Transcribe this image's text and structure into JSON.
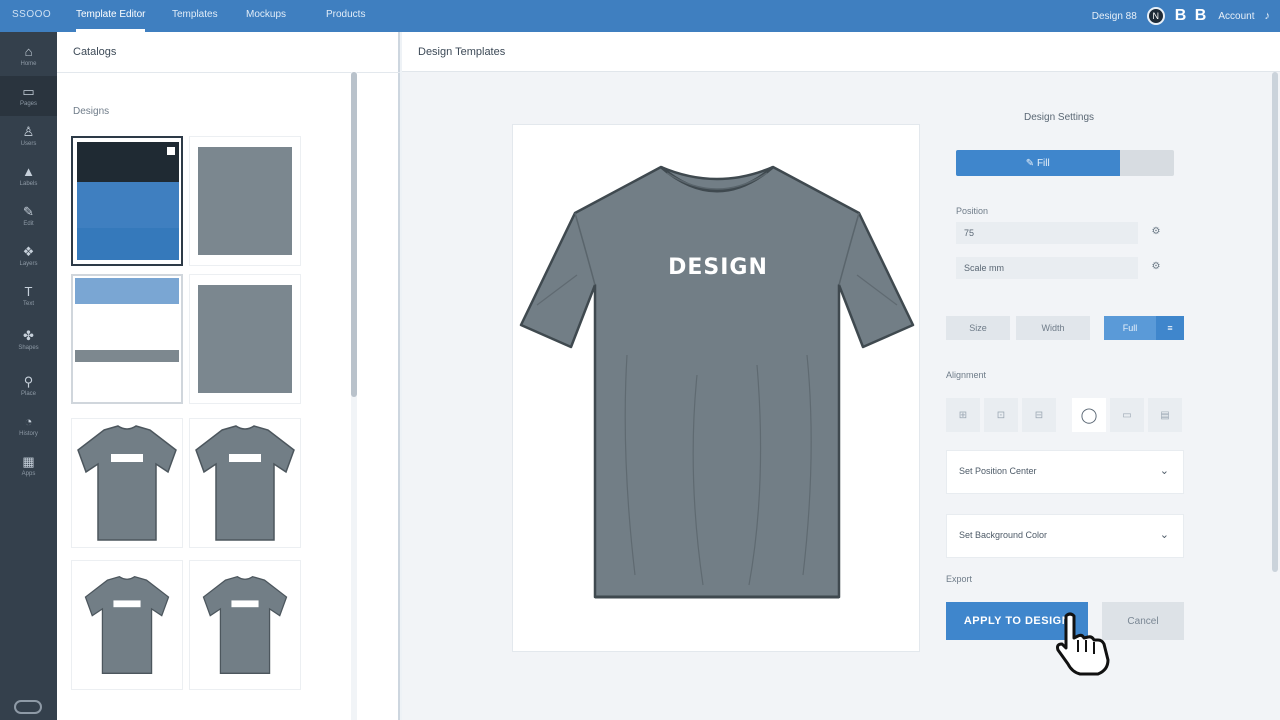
{
  "app": {
    "brand": "SSOOO",
    "tabs": [
      "Template Editor",
      "Templates",
      "Mockups",
      "Products"
    ],
    "active_tab": 0,
    "top_right": {
      "user_text": "Design 88",
      "avatar_initial": "N",
      "bb": "B B",
      "account_text": "Account"
    },
    "accent": "#3f7fc0"
  },
  "rail": {
    "items": [
      {
        "icon": "home-icon",
        "glyph": "⌂",
        "label": "Home"
      },
      {
        "icon": "file-icon",
        "glyph": "▭",
        "label": "Pages"
      },
      {
        "icon": "user-icon",
        "glyph": "♙",
        "label": "Users"
      },
      {
        "icon": "tag-icon",
        "glyph": "▲",
        "label": "Labels"
      },
      {
        "icon": "edit-icon",
        "glyph": "✎",
        "label": "Edit"
      },
      {
        "icon": "layers-icon",
        "glyph": "❖",
        "label": "Layers"
      },
      {
        "icon": "text-icon",
        "glyph": "T",
        "label": "Text"
      },
      {
        "icon": "share-icon",
        "glyph": "✤",
        "label": "Shapes"
      },
      {
        "icon": "pin-icon",
        "glyph": "⚲",
        "label": "Place"
      },
      {
        "icon": "clock-icon",
        "glyph": "◔",
        "label": "History"
      },
      {
        "icon": "grid-icon",
        "glyph": "▦",
        "label": "Apps"
      }
    ]
  },
  "left_panel": {
    "title": "Catalogs",
    "section": "Designs",
    "shirt_label": "DESIGN"
  },
  "canvas": {
    "title": "Design Templates",
    "shirt_text": "DESIGN",
    "shirt_color": "#727e86"
  },
  "properties": {
    "title": "Design Settings",
    "bar_label": "✎ Fill",
    "bar_fill_fraction": 0.75,
    "label_size": "Position",
    "field_1": "75",
    "field_2": "Scale   mm",
    "seg_labels": [
      "Size",
      "Width",
      "Full",
      "≡"
    ],
    "section_tools": "Alignment",
    "tools": [
      "⊞",
      "⊡",
      "⊟",
      "◯",
      "▭",
      "▤"
    ],
    "dropdown_1": "Set Position Center",
    "dropdown_2": "Set Background Color",
    "label_export": "Export",
    "btn_primary": "APPLY TO DESIGN",
    "btn_secondary": "Cancel"
  }
}
